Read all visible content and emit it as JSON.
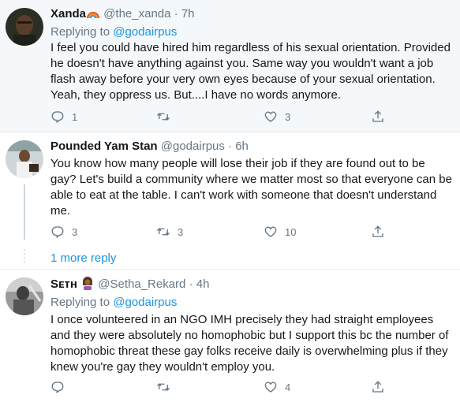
{
  "tweets": [
    {
      "name": "Xanda",
      "handle": "@the_xanda",
      "dot": "·",
      "time": "7h",
      "replying_label": "Replying to",
      "replying_to": "@godairpus",
      "text": "I feel you could have hired him regardless of his sexual orientation. Provided he doesn't have anything against you. Same way you wouldn't want a job flash away before your very own eyes because of your sexual orientation. Yeah, they oppress us. But....I have no words anymore.",
      "reply_count": "1",
      "retweet_count": "",
      "like_count": "3"
    },
    {
      "name": "Pounded Yam Stan",
      "handle": "@godairpus",
      "dot": "·",
      "time": "6h",
      "text": "You know how many people will lose their job if they are found out to be gay? Let's build a community where we matter most so that everyone can be able to eat at the table. I can't work with someone that doesn't understand me.",
      "reply_count": "3",
      "retweet_count": "3",
      "like_count": "10"
    },
    {
      "name": "Sᴇᴛʜ",
      "handle": "@Setha_Rekard",
      "dot": "·",
      "time": "4h",
      "replying_label": "Replying to",
      "replying_to": "@godairpus",
      "text": "I once volunteered in an NGO IMH precisely they had straight employees and they were absolutely no homophobic but I support this bc the number of homophobic threat these gay folks receive daily is overwhelming plus if they knew you're gay they wouldn't employ you.",
      "reply_count": "",
      "retweet_count": "",
      "like_count": "4"
    }
  ],
  "more_replies": "1 more reply",
  "colors": {
    "accent": "#1b95e0",
    "muted": "#657786",
    "highlight_bg": "#f5f8fa"
  },
  "icons": [
    "reply-icon",
    "retweet-icon",
    "like-icon",
    "share-icon",
    "rainbow-emoji",
    "woman-emoji"
  ]
}
